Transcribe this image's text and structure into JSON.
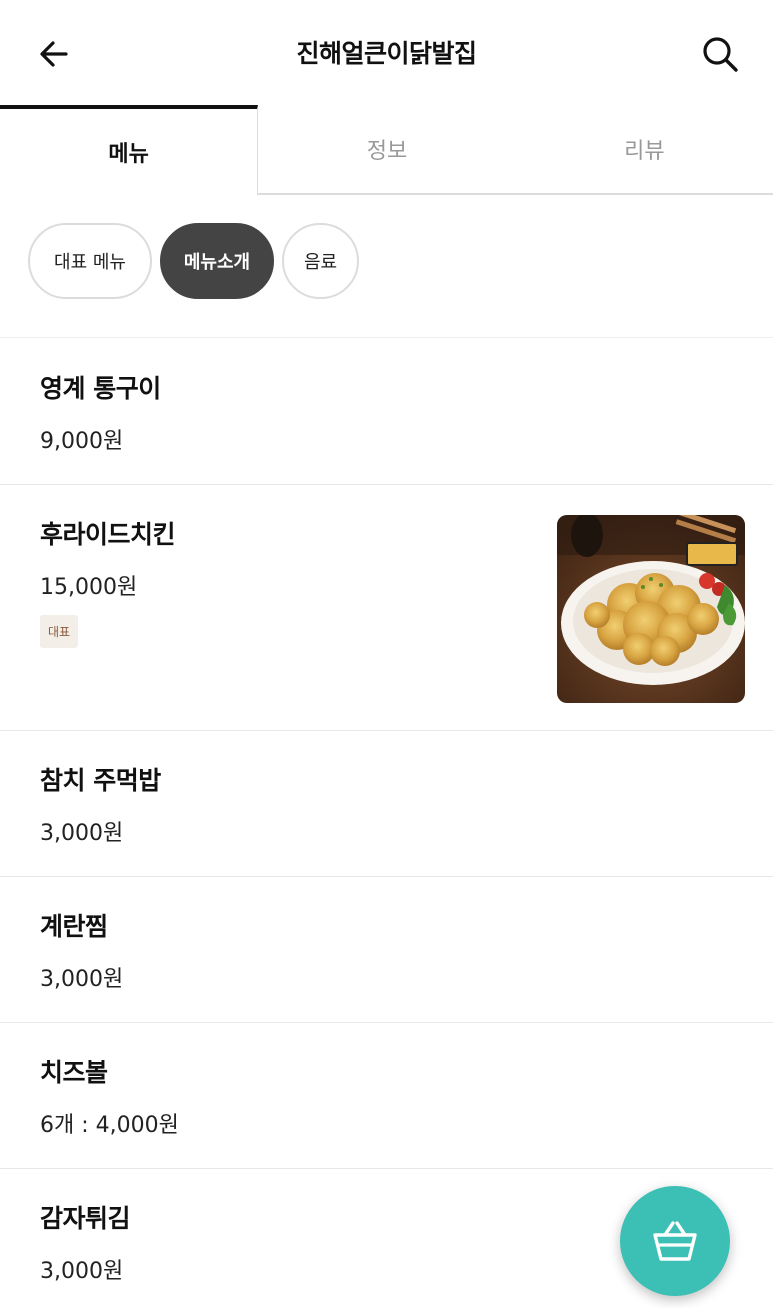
{
  "header": {
    "title": "진해얼큰이닭발집",
    "back_icon": "arrow-left-icon",
    "search_icon": "search-icon"
  },
  "tabs": [
    {
      "label": "메뉴",
      "active": true
    },
    {
      "label": "정보",
      "active": false
    },
    {
      "label": "리뷰",
      "active": false
    }
  ],
  "categories": [
    {
      "label": "대표 메뉴",
      "active": false
    },
    {
      "label": "메뉴소개",
      "active": true
    },
    {
      "label": "음료",
      "active": false
    }
  ],
  "menu": [
    {
      "name": "영계 통구이",
      "price": "9,000원"
    },
    {
      "name": "후라이드치킨",
      "price": "15,000원",
      "badge": "대표",
      "image": "fried-chicken-photo"
    },
    {
      "name": "참치 주먹밥",
      "price": "3,000원"
    },
    {
      "name": "계란찜",
      "price": "3,000원"
    },
    {
      "name": "치즈볼",
      "price": "6개 : 4,000원"
    },
    {
      "name": "감자튀김",
      "price": "3,000원"
    }
  ],
  "cart": {
    "icon": "basket-icon",
    "color": "#3cbfb5"
  }
}
